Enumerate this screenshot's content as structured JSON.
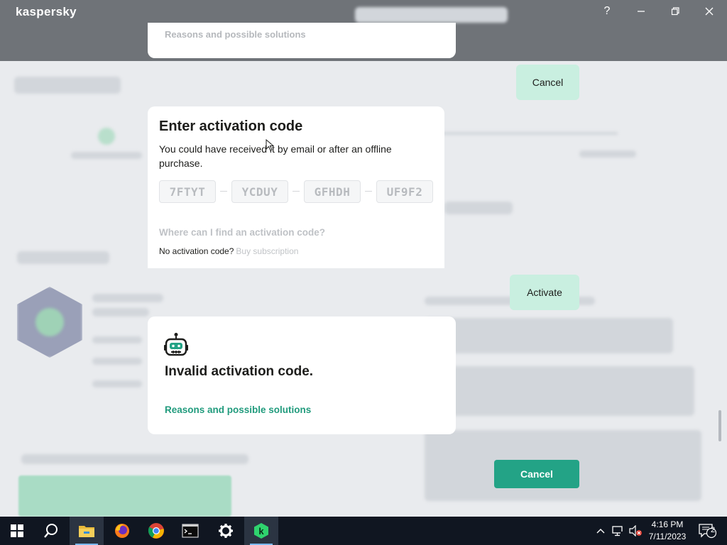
{
  "window": {
    "logo": "kaspersky",
    "help_icon": "question-mark-icon",
    "minimize_icon": "minimize-icon",
    "maximize_icon": "maximize-icon",
    "close_icon": "close-icon"
  },
  "top_card": {
    "link": "Reasons and possible solutions"
  },
  "activation": {
    "title": "Enter activation code",
    "description": "You could have received it by email or after an offline purchase.",
    "code_segments": [
      "7FTYT",
      "YCDUY",
      "GFHDH",
      "UF9F2"
    ],
    "find_link": "Where can I find an activation code?",
    "no_code_text": "No activation code?",
    "buy_link": "Buy subscription"
  },
  "error": {
    "icon": "robot-icon",
    "title": "Invalid activation code.",
    "link": "Reasons and possible solutions"
  },
  "buttons": {
    "cancel_top": "Cancel",
    "activate": "Activate",
    "cancel_main": "Cancel"
  },
  "colors": {
    "accent": "#23a386",
    "accent_light": "#c9efe0",
    "link_green": "#219b7d"
  },
  "taskbar": {
    "apps": [
      "windows-start-icon",
      "search-icon",
      "file-explorer-icon",
      "firefox-icon",
      "chrome-icon",
      "terminal-icon",
      "settings-gear-icon",
      "kaspersky-icon"
    ],
    "tray": [
      "chevron-up-icon",
      "network-icon",
      "volume-muted-icon"
    ],
    "time": "4:16 PM",
    "date": "7/11/2023",
    "notification_count": "2"
  }
}
